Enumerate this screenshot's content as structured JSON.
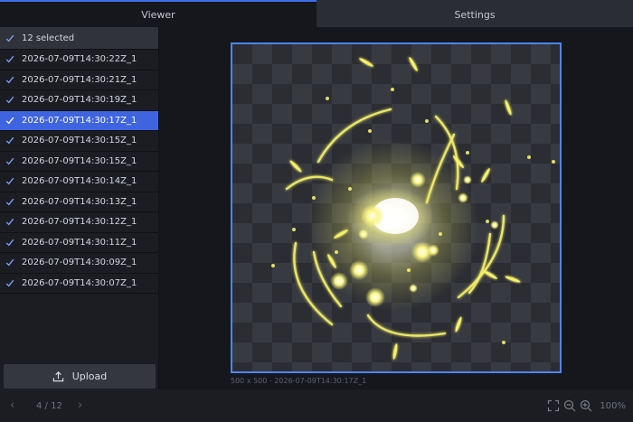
{
  "tabs": [
    {
      "label": "Viewer",
      "active": true
    },
    {
      "label": "Settings",
      "active": false
    }
  ],
  "list": {
    "header_label": "12 selected",
    "items": [
      {
        "label": "2026-07-09T14:30:22Z_1",
        "checked": true,
        "selected": false
      },
      {
        "label": "2026-07-09T14:30:21Z_1",
        "checked": true,
        "selected": false
      },
      {
        "label": "2026-07-09T14:30:19Z_1",
        "checked": true,
        "selected": false
      },
      {
        "label": "2026-07-09T14:30:17Z_1",
        "checked": true,
        "selected": true
      },
      {
        "label": "2026-07-09T14:30:15Z_1",
        "checked": true,
        "selected": false
      },
      {
        "label": "2026-07-09T14:30:15Z_1",
        "checked": true,
        "selected": false
      },
      {
        "label": "2026-07-09T14:30:14Z_1",
        "checked": true,
        "selected": false
      },
      {
        "label": "2026-07-09T14:30:13Z_1",
        "checked": true,
        "selected": false
      },
      {
        "label": "2026-07-09T14:30:12Z_1",
        "checked": true,
        "selected": false
      },
      {
        "label": "2026-07-09T14:30:11Z_1",
        "checked": true,
        "selected": false
      },
      {
        "label": "2026-07-09T14:30:09Z_1",
        "checked": true,
        "selected": false
      },
      {
        "label": "2026-07-09T14:30:07Z_1",
        "checked": true,
        "selected": false
      }
    ]
  },
  "upload": {
    "label": "Upload",
    "icon": "upload-icon"
  },
  "collapse": {
    "glyph": "«",
    "icon": "collapse-sidebar-icon"
  },
  "viewer": {
    "caption": "500 x 500 - 2026-07-09T14:30:17Z_1",
    "frame_color": "#4f84f0",
    "glow_color": "#f5f06a"
  },
  "footer": {
    "prev_glyph": "‹",
    "next_glyph": "›",
    "page_indicator": "4 / 12",
    "zoom_label": "100%",
    "icons": [
      "fit-screen-icon",
      "zoom-out-icon",
      "zoom-in-icon"
    ]
  },
  "colors": {
    "accent": "#3f64e0",
    "tab_active_border": "#3f6fe8",
    "background": "#15171c"
  }
}
